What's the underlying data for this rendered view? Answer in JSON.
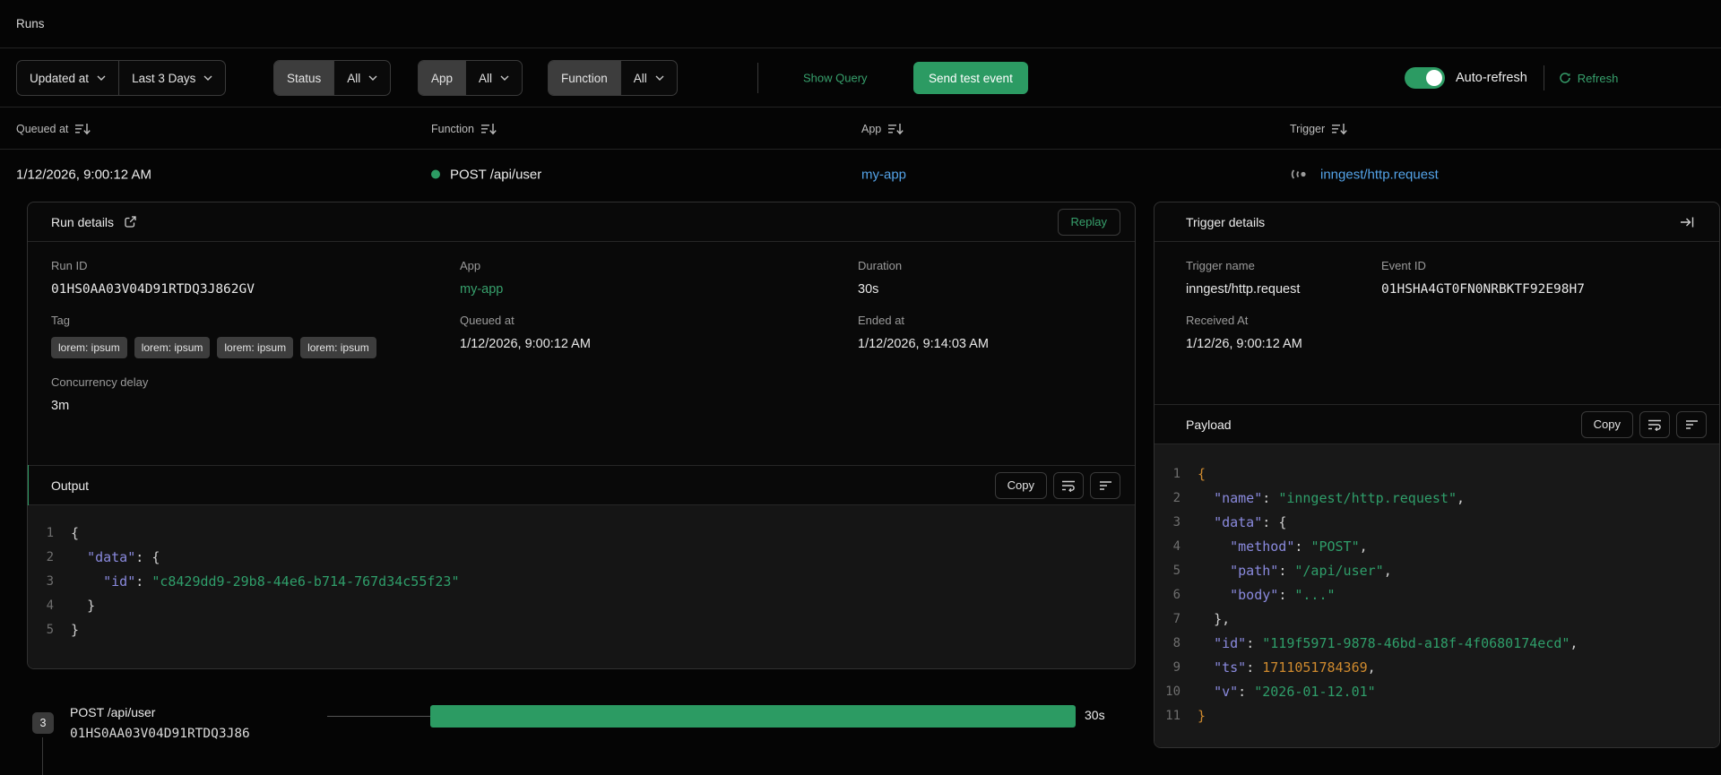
{
  "colors": {
    "accent": "#2c9b63",
    "green_text": "#37a06c",
    "link_blue": "#54a3e8",
    "code_key": "#8a8ade",
    "code_string": "#2f9e6a",
    "code_number": "#cf8a2e"
  },
  "page": {
    "title": "Runs"
  },
  "filters": {
    "sort_field": "Updated at",
    "time_range": "Last 3 Days",
    "status": {
      "label": "Status",
      "value": "All"
    },
    "app": {
      "label": "App",
      "value": "All"
    },
    "function": {
      "label": "Function",
      "value": "All"
    },
    "show_query": "Show Query",
    "send_test_event": "Send test event",
    "auto_refresh": "Auto-refresh",
    "refresh": "Refresh"
  },
  "table": {
    "columns": [
      "Queued at",
      "Function",
      "App",
      "Trigger"
    ],
    "row": {
      "queued_at": "1/12/2026, 9:00:12 AM",
      "function": "POST /api/user",
      "app": "my-app",
      "trigger": "inngest/http.request"
    }
  },
  "run_details": {
    "title": "Run details",
    "replay": "Replay",
    "run_id": {
      "label": "Run ID",
      "value": "01HS0AA03V04D91RTDQ3J862GV"
    },
    "app": {
      "label": "App",
      "value": "my-app"
    },
    "duration": {
      "label": "Duration",
      "value": "30s"
    },
    "tag": {
      "label": "Tag",
      "values": [
        "lorem: ipsum",
        "lorem: ipsum",
        "lorem: ipsum",
        "lorem: ipsum"
      ]
    },
    "queued_at": {
      "label": "Queued at",
      "value": "1/12/2026, 9:00:12 AM"
    },
    "ended_at": {
      "label": "Ended at",
      "value": "1/12/2026, 9:14:03 AM"
    },
    "concurrency_delay": {
      "label": "Concurrency delay",
      "value": "3m"
    },
    "output": {
      "title": "Output",
      "copy": "Copy",
      "code": [
        {
          "n": "1",
          "t": [
            [
              "{",
              "p"
            ]
          ]
        },
        {
          "n": "2",
          "t": [
            [
              "  ",
              "p"
            ],
            [
              "\"data\"",
              "k"
            ],
            [
              ": ",
              "p"
            ],
            [
              "{",
              "p"
            ]
          ]
        },
        {
          "n": "3",
          "t": [
            [
              "    ",
              "p"
            ],
            [
              "\"id\"",
              "k"
            ],
            [
              ": ",
              "p"
            ],
            [
              "\"c8429dd9-29b8-44e6-b714-767d34c55f23\"",
              "s"
            ]
          ]
        },
        {
          "n": "4",
          "t": [
            [
              "  ",
              "p"
            ],
            [
              "}",
              "p"
            ]
          ]
        },
        {
          "n": "5",
          "t": [
            [
              "}",
              "p"
            ]
          ]
        }
      ]
    }
  },
  "trigger_details": {
    "title": "Trigger details",
    "trigger_name": {
      "label": "Trigger name",
      "value": "inngest/http.request"
    },
    "event_id": {
      "label": "Event ID",
      "value": "01HSHA4GT0FN0NRBKTF92E98H7"
    },
    "received_at": {
      "label": "Received At",
      "value": "1/12/26, 9:00:12 AM"
    },
    "payload": {
      "title": "Payload",
      "copy": "Copy",
      "code": [
        {
          "n": "1",
          "t": [
            [
              "{",
              "o"
            ]
          ]
        },
        {
          "n": "2",
          "t": [
            [
              "  ",
              "p"
            ],
            [
              "\"name\"",
              "k"
            ],
            [
              ": ",
              "p"
            ],
            [
              "\"inngest/http.request\"",
              "s"
            ],
            [
              ",",
              "p"
            ]
          ]
        },
        {
          "n": "3",
          "t": [
            [
              "  ",
              "p"
            ],
            [
              "\"data\"",
              "k"
            ],
            [
              ": ",
              "p"
            ],
            [
              "{",
              "p"
            ]
          ]
        },
        {
          "n": "4",
          "t": [
            [
              "    ",
              "p"
            ],
            [
              "\"method\"",
              "k"
            ],
            [
              ": ",
              "p"
            ],
            [
              "\"POST\"",
              "s"
            ],
            [
              ",",
              "p"
            ]
          ]
        },
        {
          "n": "5",
          "t": [
            [
              "    ",
              "p"
            ],
            [
              "\"path\"",
              "k"
            ],
            [
              ": ",
              "p"
            ],
            [
              "\"/api/user\"",
              "s"
            ],
            [
              ",",
              "p"
            ]
          ]
        },
        {
          "n": "6",
          "t": [
            [
              "    ",
              "p"
            ],
            [
              "\"body\"",
              "k"
            ],
            [
              ": ",
              "p"
            ],
            [
              "\"...\"",
              "s"
            ]
          ]
        },
        {
          "n": "7",
          "t": [
            [
              "  ",
              "p"
            ],
            [
              "}",
              "p"
            ],
            [
              ",",
              "p"
            ]
          ]
        },
        {
          "n": "8",
          "t": [
            [
              "  ",
              "p"
            ],
            [
              "\"id\"",
              "k"
            ],
            [
              ": ",
              "p"
            ],
            [
              "\"119f5971-9878-46bd-a18f-4f0680174ecd\"",
              "s"
            ],
            [
              ",",
              "p"
            ]
          ]
        },
        {
          "n": "9",
          "t": [
            [
              "  ",
              "p"
            ],
            [
              "\"ts\"",
              "k"
            ],
            [
              ": ",
              "p"
            ],
            [
              "1711051784369",
              "n"
            ],
            [
              ",",
              "p"
            ]
          ]
        },
        {
          "n": "10",
          "t": [
            [
              "  ",
              "p"
            ],
            [
              "\"v\"",
              "k"
            ],
            [
              ": ",
              "p"
            ],
            [
              "\"2026-01-12.01\"",
              "s"
            ]
          ]
        },
        {
          "n": "11",
          "t": [
            [
              "}",
              "o"
            ]
          ]
        }
      ]
    }
  },
  "timeline": {
    "step_count": "3",
    "function": "POST /api/user",
    "run_id": "01HS0AA03V04D91RTDQ3J86",
    "duration": "30s"
  }
}
